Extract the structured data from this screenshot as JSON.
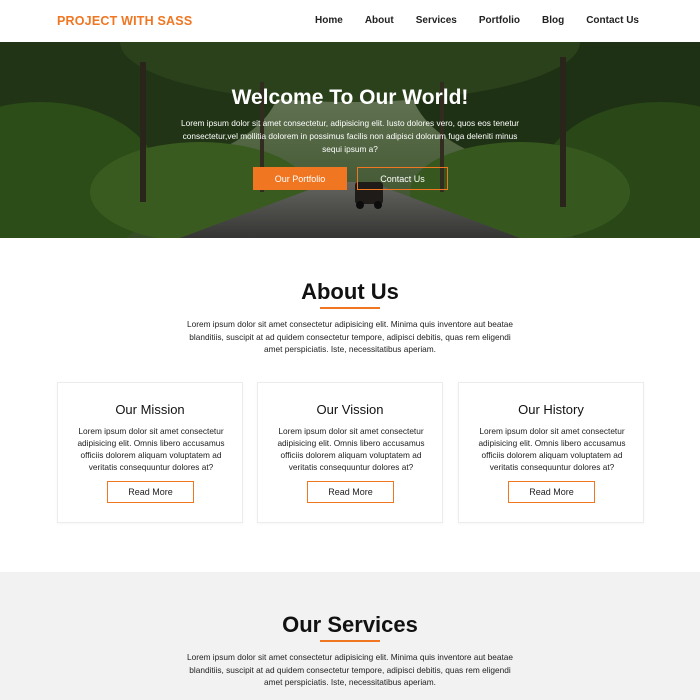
{
  "nav": {
    "brand": "PROJECT WITH SASS",
    "items": [
      "Home",
      "About",
      "Services",
      "Portfolio",
      "Blog",
      "Contact Us"
    ]
  },
  "hero": {
    "title": "Welcome To Our World!",
    "text": "Lorem ipsum dolor sit amet consectetur, adipisicing elit. Iusto dolores vero, quos eos tenetur consectetur,vel mollitia dolorem in possimus facilis non adipisci dolorum fuga deleniti minus sequi ipsum a?",
    "primary_button": "Our Portfolio",
    "secondary_button": "Contact Us"
  },
  "about": {
    "title": "About Us",
    "text": "Lorem ipsum dolor sit amet consectetur adipisicing elit. Minima quis inventore aut beatae blanditiis, suscipit at ad quidem consectetur tempore, adipisci debitis, quas rem eligendi amet perspiciatis. Iste, necessitatibus aperiam.",
    "cards": [
      {
        "title": "Our Mission",
        "text": "Lorem ipsum dolor sit amet consectetur adipisicing elit. Omnis libero accusamus officiis dolorem aliquam voluptatem ad veritatis consequuntur dolores at?",
        "button": "Read More"
      },
      {
        "title": "Our Vission",
        "text": "Lorem ipsum dolor sit amet consectetur adipisicing elit. Omnis libero accusamus officiis dolorem aliquam voluptatem ad veritatis consequuntur dolores at?",
        "button": "Read More"
      },
      {
        "title": "Our History",
        "text": "Lorem ipsum dolor sit amet consectetur adipisicing elit. Omnis libero accusamus officiis dolorem aliquam voluptatem ad veritatis consequuntur dolores at?",
        "button": "Read More"
      }
    ]
  },
  "services": {
    "title": "Our Services",
    "text": "Lorem ipsum dolor sit amet consectetur adipisicing elit. Minima quis inventore aut beatae blanditiis, suscipit at ad quidem consectetur tempore, adipisci debitis, quas rem eligendi amet perspiciatis. Iste, necessitatibus aperiam."
  },
  "colors": {
    "accent": "#f07622",
    "services_bg": "#f2f2f2"
  }
}
